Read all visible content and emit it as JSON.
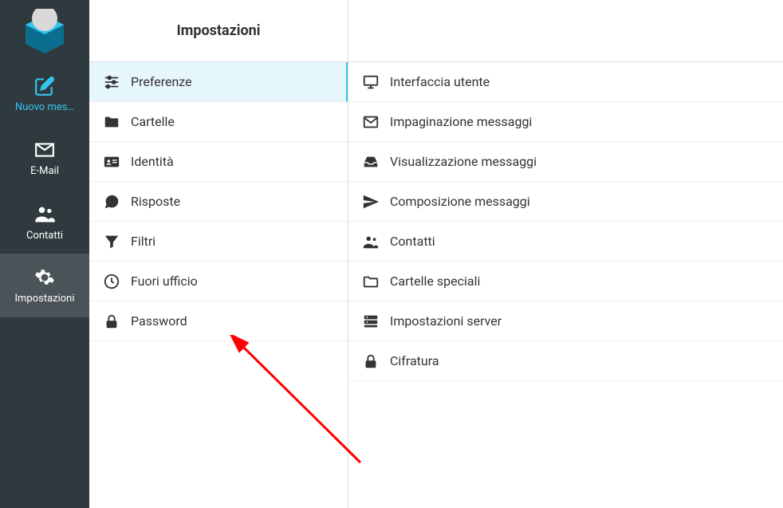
{
  "sidebar": {
    "items": [
      {
        "label": "Nuovo mes…"
      },
      {
        "label": "E-Mail"
      },
      {
        "label": "Contatti"
      },
      {
        "label": "Impostazioni"
      }
    ]
  },
  "col2": {
    "title": "Impostazioni",
    "items": [
      {
        "label": "Preferenze"
      },
      {
        "label": "Cartelle"
      },
      {
        "label": "Identità"
      },
      {
        "label": "Risposte"
      },
      {
        "label": "Filtri"
      },
      {
        "label": "Fuori ufficio"
      },
      {
        "label": "Password"
      }
    ]
  },
  "col3": {
    "items": [
      {
        "label": "Interfaccia utente"
      },
      {
        "label": "Impaginazione messaggi"
      },
      {
        "label": "Visualizzazione messaggi"
      },
      {
        "label": "Composizione messaggi"
      },
      {
        "label": "Contatti"
      },
      {
        "label": "Cartelle speciali"
      },
      {
        "label": "Impostazioni server"
      },
      {
        "label": "Cifratura"
      }
    ]
  }
}
